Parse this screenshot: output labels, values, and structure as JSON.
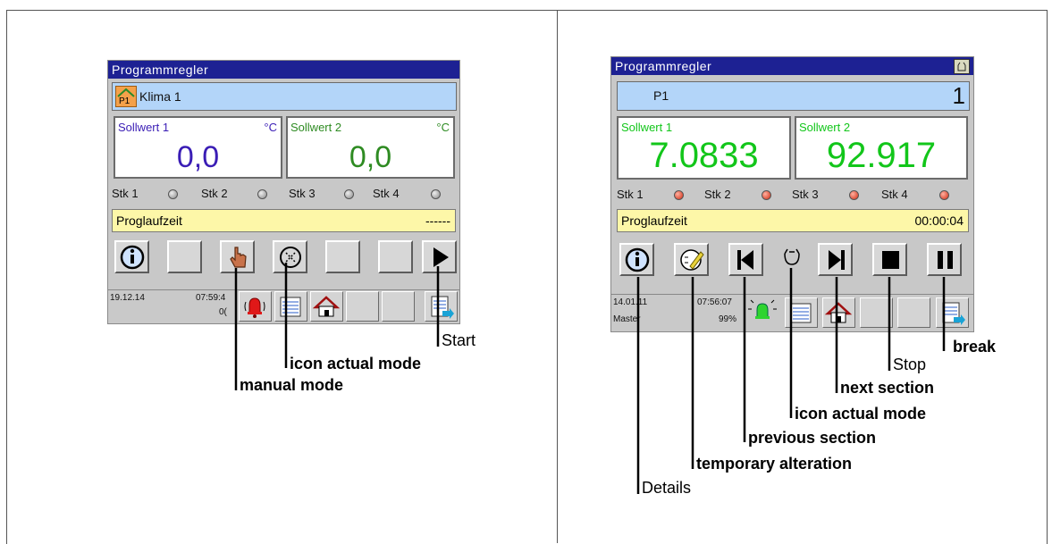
{
  "left_panel": {
    "title": "Programmregler",
    "program_badge": "P1",
    "program_name": "Klima 1",
    "setpoint1": {
      "label": "Sollwert 1",
      "unit": "°C",
      "value": "0,0",
      "color": "#3a1db5"
    },
    "setpoint2": {
      "label": "Sollwert 2",
      "unit": "°C",
      "value": "0,0",
      "color": "#2e8b22"
    },
    "stk": [
      {
        "label": "Stk 1",
        "state": "grey"
      },
      {
        "label": "Stk 2",
        "state": "grey"
      },
      {
        "label": "Stk 3",
        "state": "grey"
      },
      {
        "label": "Stk 4",
        "state": "grey"
      }
    ],
    "runtime_label": "Proglaufzeit",
    "runtime_value": "------",
    "status": {
      "date": "19.12.14",
      "time": "07:59:4",
      "extra": "0("
    }
  },
  "right_panel": {
    "title": "Programmregler",
    "program_name": "P1",
    "program_number": "1",
    "setpoint1": {
      "label": "Sollwert 1",
      "value": "7.0833",
      "color": "#12c61a"
    },
    "setpoint2": {
      "label": "Sollwert 2",
      "value": "92.917",
      "color": "#12c61a"
    },
    "stk": [
      {
        "label": "Stk 1",
        "state": "red"
      },
      {
        "label": "Stk 2",
        "state": "red"
      },
      {
        "label": "Stk 3",
        "state": "red"
      },
      {
        "label": "Stk 4",
        "state": "red"
      }
    ],
    "runtime_label": "Proglaufzeit",
    "runtime_value": "00:00:04",
    "status": {
      "date": "14.01.11",
      "time": "07:56:07",
      "user": "Master",
      "percent": "99%"
    }
  },
  "callouts": {
    "start": "Start",
    "icon_actual_mode_left": "icon actual mode",
    "manual_mode": "manual mode",
    "break": "break",
    "stop": "Stop",
    "next_section": "next section",
    "icon_actual_mode_right": "icon actual mode",
    "previous_section": "previous section",
    "temporary_alteration": "temporary alteration",
    "details": "Details"
  },
  "icons": {
    "info": "info-icon",
    "hand": "hand-icon",
    "mode": "actual-mode-icon",
    "play": "play-icon",
    "alarm": "alarm-bell-icon",
    "list": "list-icon",
    "home": "home-icon",
    "exit": "exit-list-icon",
    "prev": "previous-section-icon",
    "next": "next-section-icon",
    "stop": "stop-icon",
    "pause": "pause-icon",
    "edit": "temporary-alteration-icon"
  }
}
